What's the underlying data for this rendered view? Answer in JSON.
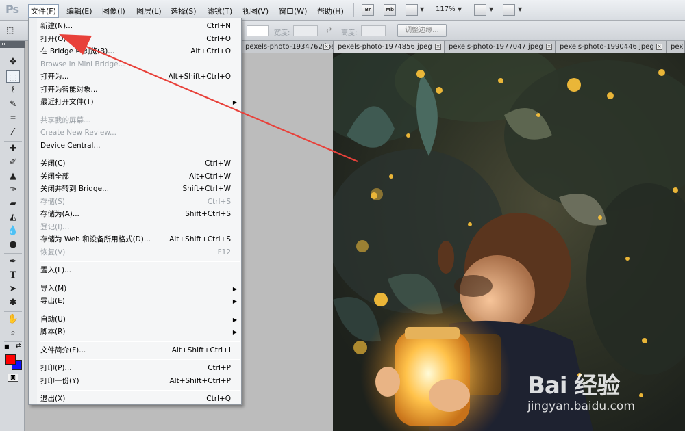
{
  "app": {
    "logo": "Ps"
  },
  "menubar": {
    "items": [
      {
        "label": "文件(F)",
        "active": true
      },
      {
        "label": "编辑(E)"
      },
      {
        "label": "图像(I)"
      },
      {
        "label": "图层(L)"
      },
      {
        "label": "选择(S)"
      },
      {
        "label": "滤镜(T)"
      },
      {
        "label": "视图(V)"
      },
      {
        "label": "窗口(W)"
      },
      {
        "label": "帮助(H)"
      }
    ],
    "bridge_btn": "Br",
    "minibridge_btn": "Mb",
    "zoom": "117%"
  },
  "options": {
    "width_label": "宽度:",
    "height_label": "高度:",
    "refine_edge": "调整边缘..."
  },
  "tabs": [
    "pexels-photo-1934762.jpeg",
    "pexels-photo-1974856.jpeg",
    "pexels-photo-1977047.jpeg",
    "pexels-photo-1990446.jpeg",
    "pex"
  ],
  "file_menu": {
    "groups": [
      [
        {
          "label": "新建(N)...",
          "shortcut": "Ctrl+N"
        },
        {
          "label": "打开(O)...",
          "shortcut": "Ctrl+O"
        },
        {
          "label": "在 Bridge 中浏览(B)...",
          "shortcut": "Alt+Ctrl+O"
        },
        {
          "label": "Browse in Mini Bridge...",
          "shortcut": "",
          "disabled": true
        },
        {
          "label": "打开为...",
          "shortcut": "Alt+Shift+Ctrl+O"
        },
        {
          "label": "打开为智能对象...",
          "shortcut": ""
        },
        {
          "label": "最近打开文件(T)",
          "shortcut": "",
          "submenu": true
        }
      ],
      [
        {
          "label": "共享我的屏幕...",
          "shortcut": "",
          "disabled": true
        },
        {
          "label": "Create New Review...",
          "shortcut": "",
          "disabled": true
        },
        {
          "label": "Device Central...",
          "shortcut": ""
        }
      ],
      [
        {
          "label": "关闭(C)",
          "shortcut": "Ctrl+W"
        },
        {
          "label": "关闭全部",
          "shortcut": "Alt+Ctrl+W"
        },
        {
          "label": "关闭并转到 Bridge...",
          "shortcut": "Shift+Ctrl+W"
        },
        {
          "label": "存储(S)",
          "shortcut": "Ctrl+S",
          "disabled": true
        },
        {
          "label": "存储为(A)...",
          "shortcut": "Shift+Ctrl+S"
        },
        {
          "label": "登记(I)...",
          "shortcut": "",
          "disabled": true
        },
        {
          "label": "存储为 Web 和设备所用格式(D)...",
          "shortcut": "Alt+Shift+Ctrl+S"
        },
        {
          "label": "恢复(V)",
          "shortcut": "F12",
          "disabled": true
        }
      ],
      [
        {
          "label": "置入(L)...",
          "shortcut": ""
        }
      ],
      [
        {
          "label": "导入(M)",
          "shortcut": "",
          "submenu": true
        },
        {
          "label": "导出(E)",
          "shortcut": "",
          "submenu": true
        }
      ],
      [
        {
          "label": "自动(U)",
          "shortcut": "",
          "submenu": true
        },
        {
          "label": "脚本(R)",
          "shortcut": "",
          "submenu": true
        }
      ],
      [
        {
          "label": "文件简介(F)...",
          "shortcut": "Alt+Shift+Ctrl+I"
        }
      ],
      [
        {
          "label": "打印(P)...",
          "shortcut": "Ctrl+P"
        },
        {
          "label": "打印一份(Y)",
          "shortcut": "Alt+Shift+Ctrl+P"
        }
      ],
      [
        {
          "label": "退出(X)",
          "shortcut": "Ctrl+Q"
        }
      ]
    ]
  },
  "watermark": {
    "brand": "Bai 经验",
    "url": "jingyan.baidu.com"
  },
  "colors": {
    "foreground": "#ff0000",
    "background": "#1010ff",
    "annotation_arrow": "#e8413a"
  },
  "tools": [
    "move-icon",
    "marquee-icon",
    "lasso-icon",
    "quick-select-icon",
    "crop-icon",
    "eyedropper-icon",
    "healing-icon",
    "brush-icon",
    "stamp-icon",
    "history-brush-icon",
    "eraser-icon",
    "gradient-icon",
    "blur-icon",
    "dodge-icon",
    "pen-icon",
    "type-icon",
    "path-select-icon",
    "shape-icon",
    "hand-icon",
    "zoom-icon"
  ]
}
